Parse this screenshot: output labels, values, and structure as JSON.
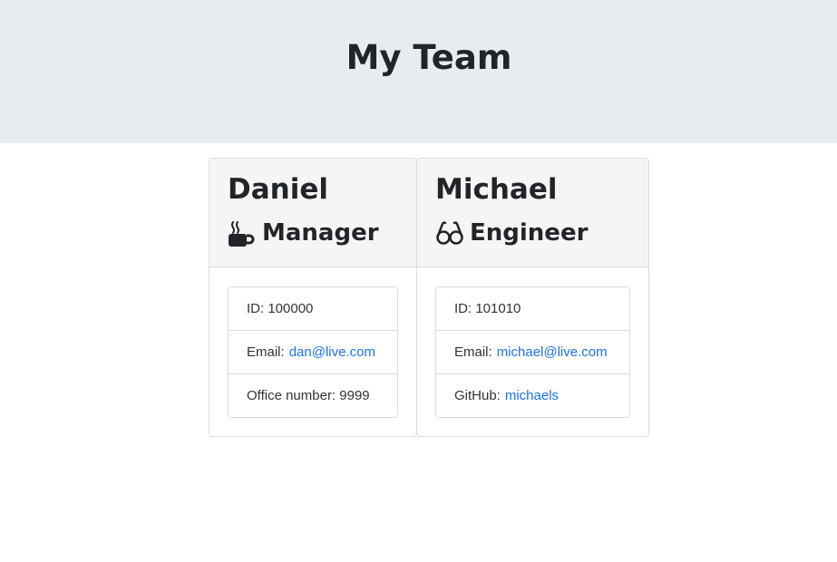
{
  "header": {
    "title": "My Team",
    "background_color": "#e9ecef"
  },
  "employees": [
    {
      "name": "Daniel",
      "role": "Manager",
      "role_icon": "mug-hot-icon",
      "details": [
        {
          "label": "ID: 100000"
        },
        {
          "label": "Email:",
          "link": "dan@live.com"
        },
        {
          "label": "Office number: 9999"
        }
      ]
    },
    {
      "name": "Michael",
      "role": "Engineer",
      "role_icon": "glasses-icon",
      "details": [
        {
          "label": "ID: 101010"
        },
        {
          "label": "Email:",
          "link": "michael@live.com"
        },
        {
          "label": "GitHub:",
          "link": "michaels"
        }
      ]
    }
  ],
  "colors": {
    "link": "#1a73e8",
    "card_header_bg": "#f5f5f5",
    "border": "#dcdcdc",
    "text": "#212529"
  }
}
